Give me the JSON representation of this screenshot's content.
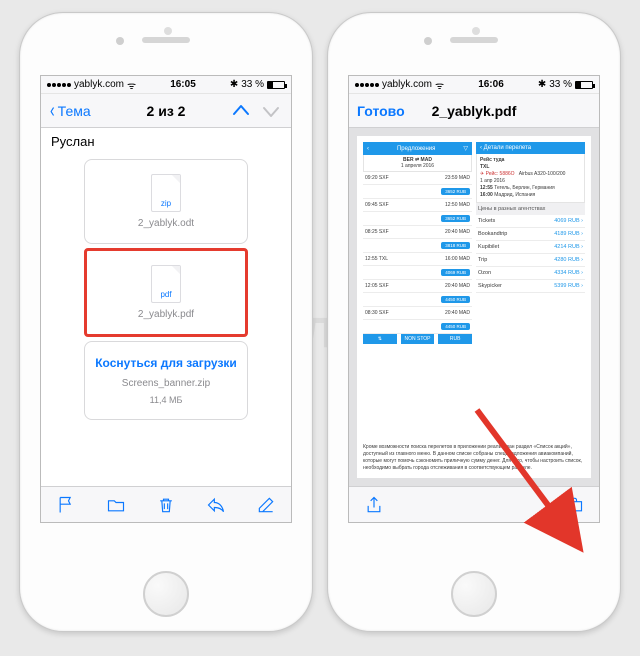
{
  "watermark": "Яблык",
  "left": {
    "status": {
      "carrier": "yablyk.com",
      "time": "16:05",
      "bt": "✱",
      "battery": "33 %"
    },
    "nav": {
      "back": "Тема",
      "title": "2 из 2"
    },
    "sender": "Руслан",
    "attachments": [
      {
        "kind": "zip",
        "filename": "2_yablyk.odt"
      },
      {
        "kind": "pdf",
        "filename": "2_yablyk.pdf",
        "highlighted": true
      },
      {
        "tap": "Коснуться для загрузки",
        "filename": "Screens_banner.zip",
        "size": "11,4 МБ"
      }
    ]
  },
  "right": {
    "status": {
      "carrier": "yablyk.com",
      "time": "16:06",
      "bt": "✱",
      "battery": "33 %"
    },
    "nav": {
      "done": "Готово",
      "title": "2_yablyk.pdf"
    },
    "pdf": {
      "colA": {
        "header": "Предложения",
        "route": "BER ⇌ MAD",
        "route_sub": "1 апреля 2016",
        "rows": [
          {
            "dep": "09:20",
            "from": "SXF",
            "arr": "23:59",
            "to": "MAD",
            "btn": "3652 RUB"
          },
          {
            "dep": "09:45",
            "from": "SXF",
            "arr": "12:50",
            "to": "MAD",
            "btn": "3652 RUB"
          },
          {
            "dep": "08:25",
            "from": "SXF",
            "arr": "20:40",
            "to": "MAD",
            "btn": "3818 RUB"
          },
          {
            "dep": "12:55",
            "from": "TXL",
            "arr": "16:00",
            "to": "MAD",
            "btn": "4069 RUB"
          },
          {
            "dep": "12:05",
            "from": "SXF",
            "arr": "20:40",
            "to": "MAD",
            "btn": "4450 RUB"
          },
          {
            "dep": "08:30",
            "from": "SXF",
            "arr": "20:40",
            "to": "MAD",
            "btn": "4450 RUB"
          }
        ],
        "footer": [
          "⇅",
          "NON STOP",
          "RUB"
        ]
      },
      "colB": {
        "header": "Детали перелета",
        "flight": "Рейс туда",
        "airport": "TXL",
        "carrier_line": "✈ Рейс: 5886О",
        "note": "Airbus A320-100/200",
        "date": "1 апр 2016",
        "dep": "12:55",
        "dep_city": "Тегель, Берлин, Германия",
        "arr": "16:00",
        "arr_city": "Мадрид, Испания",
        "agents_header": "Цены в разных агентствах",
        "agents": [
          {
            "name": "Tickets",
            "price": "4069 RUB"
          },
          {
            "name": "Bookandtrip",
            "price": "4189 RUB"
          },
          {
            "name": "Kupibilet",
            "price": "4214 RUB"
          },
          {
            "name": "Trip",
            "price": "4280 RUB"
          },
          {
            "name": "Ozon",
            "price": "4334 RUB"
          },
          {
            "name": "Skypicker",
            "price": "5399 RUB"
          }
        ]
      },
      "paragraph": "Кроме возможности поиска перелетов в приложении реализован раздел «Список акций», доступный из главного меню. В данном списке собраны спецпредложения авиакомпаний, которые могут помочь сэкономить приличную сумму денег. Для того, чтобы настроить список, необходимо выбрать города отслеживания в соответствующем разделе."
    }
  }
}
